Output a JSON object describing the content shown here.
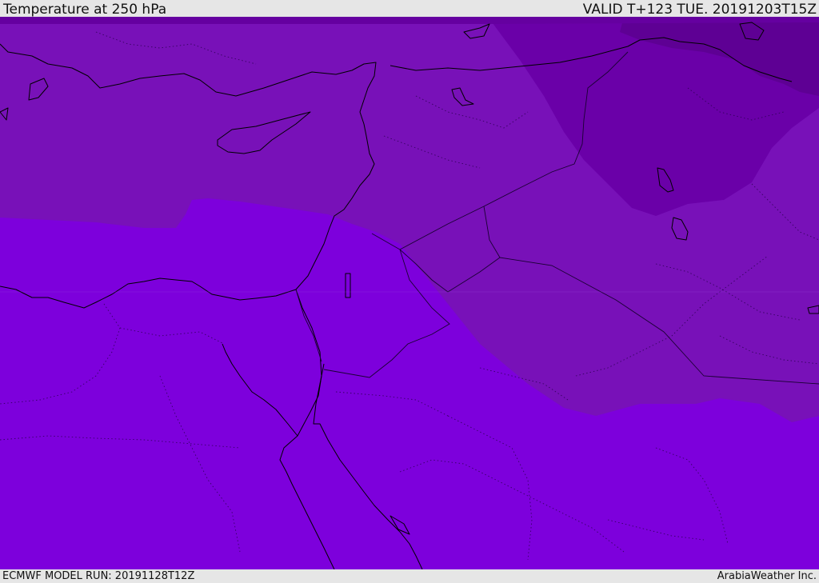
{
  "header": {
    "title": "Temperature at 250 hPa",
    "valid": "VALID T+123 TUE. 20191203T15Z"
  },
  "footer": {
    "model_run": "ECMWF MODEL RUN: 20191128T12Z",
    "credit": "ArabiaWeather Inc."
  },
  "map": {
    "colors": {
      "band_warm": "#7d00dc",
      "band_mid": "#7811b8",
      "band_cold": "#6a00a8",
      "band_coldest": "#5e0094"
    }
  }
}
